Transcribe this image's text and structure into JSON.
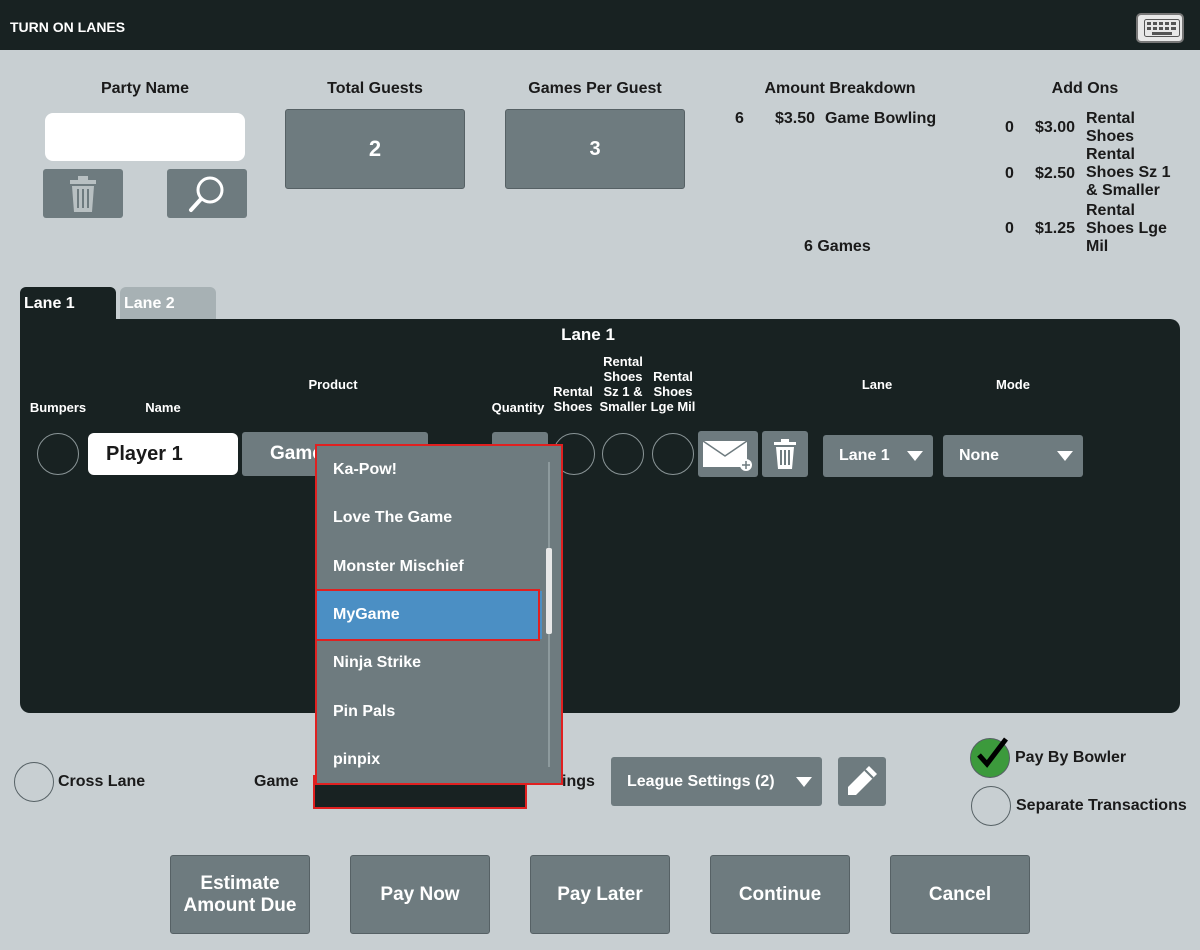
{
  "window": {
    "title": "TURN ON LANES"
  },
  "party": {
    "label": "Party Name",
    "value": ""
  },
  "guests": {
    "label": "Total Guests",
    "value": "2"
  },
  "games": {
    "label": "Games Per Guest",
    "value": "3"
  },
  "breakdown": {
    "label": "Amount Breakdown",
    "qty": "6",
    "price": "$3.50",
    "item": "Game Bowling",
    "total": "6 Games"
  },
  "addons": {
    "label": "Add Ons",
    "items": [
      {
        "qty": "0",
        "price": "$3.00",
        "name": "Rental Shoes"
      },
      {
        "qty": "0",
        "price": "$2.50",
        "name": "Rental Shoes Sz 1 & Smaller"
      },
      {
        "qty": "0",
        "price": "$1.25",
        "name": "Rental Shoes Lge Mil"
      }
    ]
  },
  "tabs": [
    {
      "label": "Lane 1"
    },
    {
      "label": "Lane 2"
    }
  ],
  "lane_panel": {
    "title": "Lane 1",
    "headers": {
      "bumpers": "Bumpers",
      "name": "Name",
      "product": "Product",
      "quantity": "Quantity",
      "rental_shoes": "Rental Shoes",
      "rental_shoes_small": "Rental Shoes Sz 1 & Smaller",
      "rental_shoes_mil": "Rental Shoes Lge Mil",
      "lane": "Lane",
      "mode": "Mode"
    },
    "row": {
      "player": "Player 1",
      "product": "Game",
      "lane": "Lane 1",
      "mode": "None"
    }
  },
  "dropdown": {
    "items": [
      "Ka-Pow!",
      "Love The Game",
      "Monster Mischief",
      "MyGame",
      "Ninja Strike",
      "Pin Pals",
      "pinpix"
    ],
    "selected": "MyGame"
  },
  "bottom": {
    "cross_lane": "Cross Lane",
    "game_label": "Game",
    "settings_label_partial": "ings",
    "league_settings": "League Settings (2)",
    "pay_by_bowler": "Pay By Bowler",
    "separate_transactions": "Separate Transactions"
  },
  "buttons": {
    "estimate": "Estimate Amount Due",
    "pay_now": "Pay Now",
    "pay_later": "Pay Later",
    "continue": "Continue",
    "cancel": "Cancel"
  },
  "colors": {
    "accent_selected": "#4b8fc4",
    "highlight_border": "#e02020",
    "check_green": "#3c9a3c"
  }
}
